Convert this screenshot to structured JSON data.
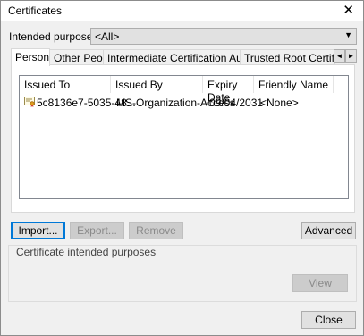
{
  "window": {
    "title": "Certificates",
    "close_glyph": "✕"
  },
  "purpose": {
    "label": "Intended purpose:",
    "value": "<All>"
  },
  "tabs": [
    {
      "label": "Personal",
      "active": true
    },
    {
      "label": "Other People",
      "active": false
    },
    {
      "label": "Intermediate Certification Authorities",
      "active": false
    },
    {
      "label": "Trusted Root Certification Authorities",
      "active": false
    }
  ],
  "tab_scroll": {
    "left": "◄",
    "right": "►"
  },
  "list": {
    "columns": [
      "Issued To",
      "Issued By",
      "Expiry Date",
      "Friendly Name"
    ],
    "rows": [
      {
        "issued_to": "5c8136e7-5035-48...",
        "issued_by": "MS-Organization-Access",
        "expiry": "09/04/2031",
        "friendly_name": "<None>",
        "icon": "certificate-icon"
      }
    ]
  },
  "buttons": {
    "import": "Import...",
    "export": "Export...",
    "remove": "Remove",
    "advanced": "Advanced",
    "view": "View",
    "close": "Close"
  },
  "purposes_group": {
    "label": "Certificate intended purposes"
  }
}
